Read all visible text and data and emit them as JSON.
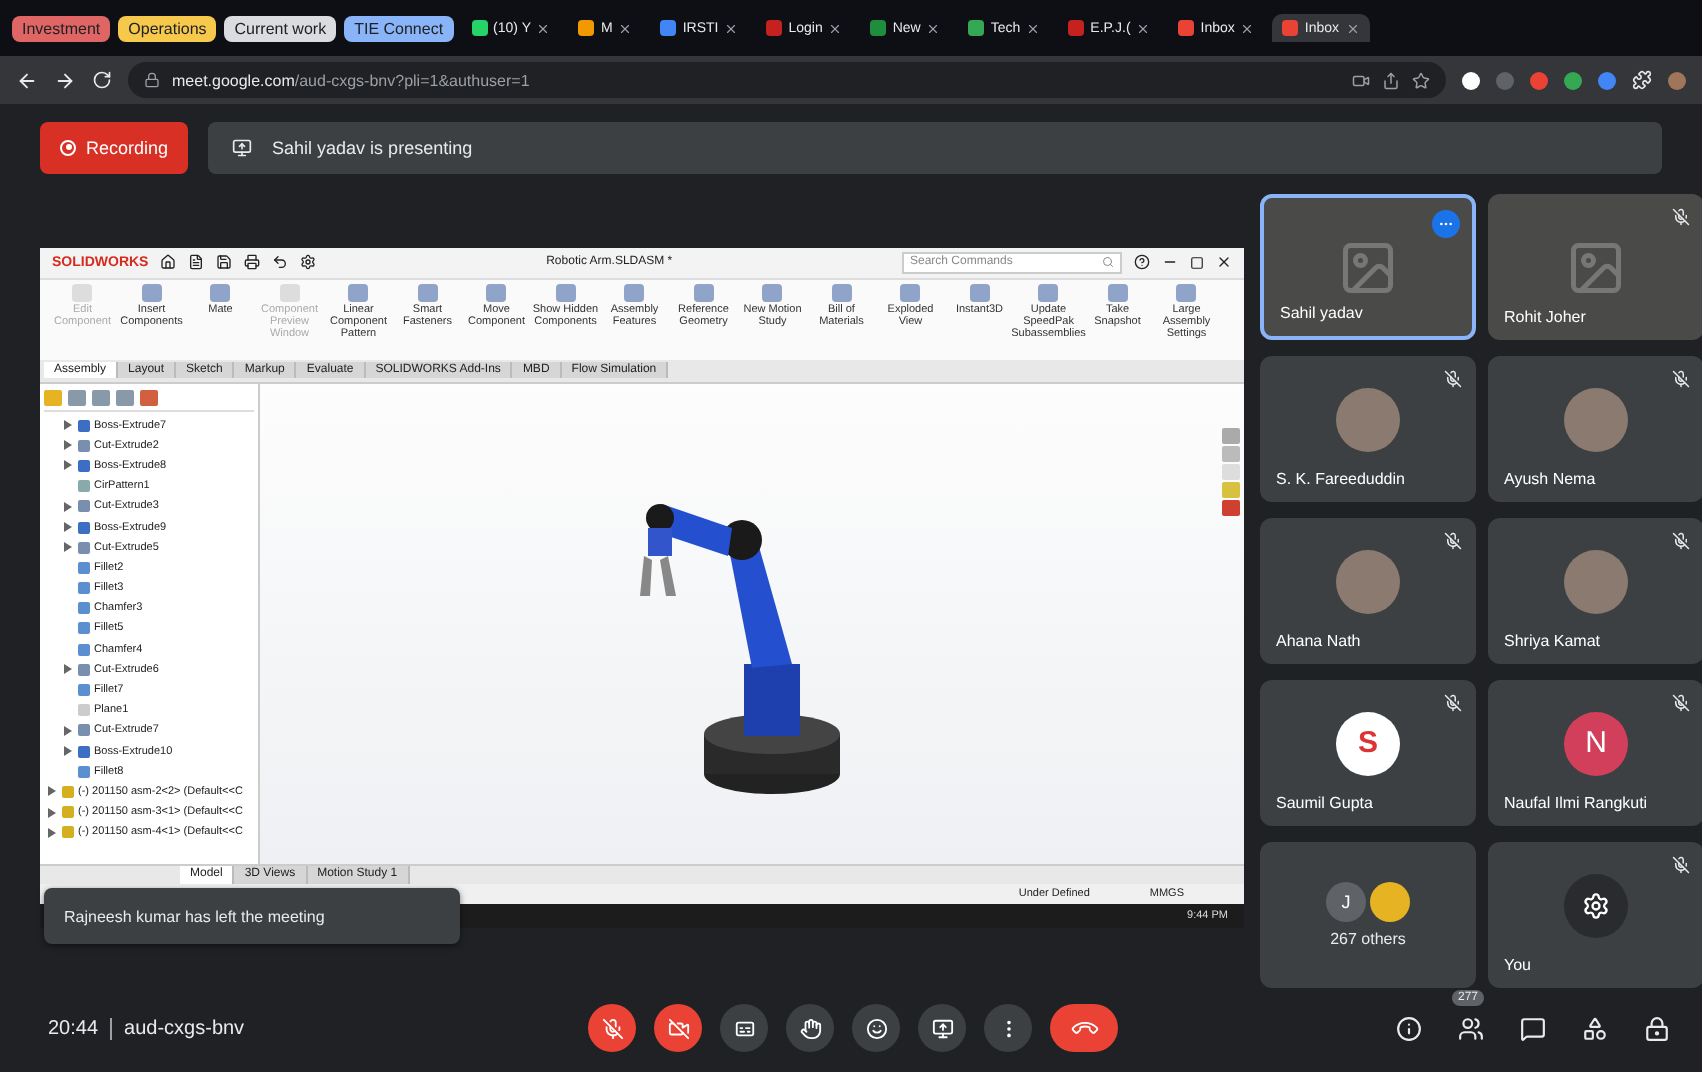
{
  "browser": {
    "tab_groups": [
      {
        "label": "Investment",
        "color": "#e06666"
      },
      {
        "label": "Operations",
        "color": "#f6c84c"
      },
      {
        "label": "Current work",
        "color": "#dadce0"
      },
      {
        "label": "TIE Connect",
        "color": "#8ab4f8"
      }
    ],
    "tabs": [
      {
        "label": "(10) Y",
        "color": "#25d366",
        "selected": false
      },
      {
        "label": "M",
        "color": "#f29900",
        "selected": false
      },
      {
        "label": "IRSTI",
        "color": "#4285f4",
        "selected": false
      },
      {
        "label": "Login",
        "color": "#c5221f",
        "selected": false
      },
      {
        "label": "New",
        "color": "#1e8e3e",
        "selected": false
      },
      {
        "label": "Tech",
        "color": "#34a853",
        "selected": false
      },
      {
        "label": "E.P.J.(",
        "color": "#c5221f",
        "selected": false
      },
      {
        "label": "Inbox",
        "color": "#ea4335",
        "selected": false
      },
      {
        "label": "Inbox",
        "color": "#ea4335",
        "selected": true
      }
    ],
    "url": "**meet.google.com**/aud-cxgs-bnv?pli=1&authuser=1"
  },
  "meet": {
    "recording": "Recording",
    "presenting": "Sahil yadav is presenting",
    "solidworks": {
      "logo": "SOLIDWORKS",
      "title": "Robotic Arm.SLDASM *",
      "search": {
        "placeholder": "Search Commands"
      },
      "ribbon": [
        {
          "label": "Edit Component",
          "disabled": true
        },
        {
          "label": "Insert Components",
          "disabled": false
        },
        {
          "label": "Mate",
          "disabled": false
        },
        {
          "label": "Component Preview Window",
          "disabled": true
        },
        {
          "label": "Linear Component Pattern",
          "disabled": false
        },
        {
          "label": "Smart Fasteners",
          "disabled": false
        },
        {
          "label": "Move Component",
          "disabled": false
        },
        {
          "label": "Show Hidden Components",
          "disabled": false
        },
        {
          "label": "Assembly Features",
          "disabled": false
        },
        {
          "label": "Reference Geometry",
          "disabled": false
        },
        {
          "label": "New Motion Study",
          "disabled": false
        },
        {
          "label": "Bill of Materials",
          "disabled": false
        },
        {
          "label": "Exploded View",
          "disabled": false
        },
        {
          "label": "Instant3D",
          "disabled": false
        },
        {
          "label": "Update SpeedPak Subassemblies",
          "disabled": false
        },
        {
          "label": "Take Snapshot",
          "disabled": false
        },
        {
          "label": "Large Assembly Settings",
          "disabled": false
        }
      ],
      "tabs": [
        {
          "label": "Assembly",
          "selected": true
        },
        {
          "label": "Layout",
          "selected": false
        },
        {
          "label": "Sketch",
          "selected": false
        },
        {
          "label": "Markup",
          "selected": false
        },
        {
          "label": "Evaluate",
          "selected": false
        },
        {
          "label": "SOLIDWORKS Add-Ins",
          "selected": false
        },
        {
          "label": "MBD",
          "selected": false
        },
        {
          "label": "Flow Simulation",
          "selected": false
        }
      ],
      "tree": [
        {
          "label": "Boss-Extrude7",
          "expandable": true,
          "kind": "boss"
        },
        {
          "label": "Cut-Extrude2",
          "expandable": true,
          "kind": "cut"
        },
        {
          "label": "Boss-Extrude8",
          "expandable": true,
          "kind": "boss"
        },
        {
          "label": "CirPattern1",
          "expandable": false,
          "kind": "pattern"
        },
        {
          "label": "Cut-Extrude3",
          "expandable": true,
          "kind": "cut"
        },
        {
          "label": "Boss-Extrude9",
          "expandable": true,
          "kind": "boss"
        },
        {
          "label": "Cut-Extrude5",
          "expandable": true,
          "kind": "cut"
        },
        {
          "label": "Fillet2",
          "expandable": false,
          "kind": "fillet"
        },
        {
          "label": "Fillet3",
          "expandable": false,
          "kind": "fillet"
        },
        {
          "label": "Chamfer3",
          "expandable": false,
          "kind": "fillet"
        },
        {
          "label": "Fillet5",
          "expandable": false,
          "kind": "fillet"
        },
        {
          "label": "Chamfer4",
          "expandable": false,
          "kind": "fillet"
        },
        {
          "label": "Cut-Extrude6",
          "expandable": true,
          "kind": "cut"
        },
        {
          "label": "Fillet7",
          "expandable": false,
          "kind": "fillet"
        },
        {
          "label": "Plane1",
          "expandable": false,
          "kind": "plane"
        },
        {
          "label": "Cut-Extrude7",
          "expandable": true,
          "kind": "cut"
        },
        {
          "label": "Boss-Extrude10",
          "expandable": true,
          "kind": "boss"
        },
        {
          "label": "Fillet8",
          "expandable": false,
          "kind": "fillet"
        }
      ],
      "components": [
        "(-) 201150 asm-2<2> (Default<<C",
        "(-) 201150 asm-3<1> (Default<<C",
        "(-) 201150 asm-4<1> (Default<<C"
      ],
      "bottom_tabs": [
        {
          "label": "Model",
          "selected": true
        },
        {
          "label": "3D Views",
          "selected": false
        },
        {
          "label": "Motion Study 1",
          "selected": false
        }
      ],
      "status": [
        "Under Defined",
        "MMGS"
      ],
      "clock": "9:44 PM"
    },
    "toast": "Rajneesh kumar has left the meeting",
    "participants": [
      {
        "name": "Sahil yadav",
        "kind": "video",
        "muted": false,
        "presenting": true
      },
      {
        "name": "Rohit Joher",
        "kind": "video",
        "muted": true,
        "presenting": false
      },
      {
        "name": "S. K. Fareeduddin",
        "kind": "photo",
        "muted": true,
        "presenting": false
      },
      {
        "name": "Ayush Nema",
        "kind": "photo",
        "muted": true,
        "presenting": false
      },
      {
        "name": "Ahana Nath",
        "kind": "photo",
        "muted": true,
        "presenting": false
      },
      {
        "name": "Shriya Kamat",
        "kind": "photo",
        "muted": true,
        "presenting": false
      },
      {
        "name": "Saumil Gupta",
        "kind": "logo",
        "letter": "S",
        "muted": true,
        "presenting": false
      },
      {
        "name": "Naufal Ilmi Rangkuti",
        "kind": "letter",
        "letter": "N",
        "color": "#d23f5a",
        "muted": true,
        "presenting": false
      },
      {
        "name": "267 others",
        "kind": "others",
        "letter": "J",
        "muted": false,
        "presenting": false
      },
      {
        "name": "You",
        "kind": "self",
        "muted": true,
        "presenting": false
      }
    ],
    "time": "20:44",
    "code": "aud-cxgs-bnv",
    "controls": [
      {
        "kind": "mic",
        "on": false
      },
      {
        "kind": "camera",
        "on": false
      },
      {
        "kind": "captions"
      },
      {
        "kind": "hand"
      },
      {
        "kind": "emoji"
      },
      {
        "kind": "present"
      },
      {
        "kind": "more"
      },
      {
        "kind": "end"
      }
    ],
    "people_count": "277"
  }
}
